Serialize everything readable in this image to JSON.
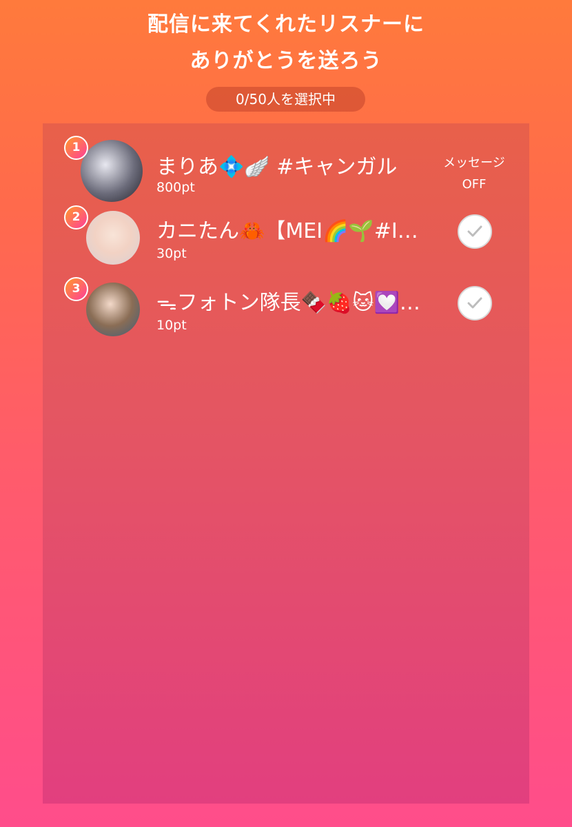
{
  "header": {
    "title_line1": "配信に来てくれたリスナーに",
    "title_line2": "ありがとうを送ろう",
    "counter": "0/50人を選択中"
  },
  "listeners": [
    {
      "rank": "1",
      "name": "まりあ💠🪽 #キャンガル",
      "points": "800pt",
      "message_status_line1": "メッセージ",
      "message_status_line2": "OFF",
      "selectable": false
    },
    {
      "rank": "2",
      "name": "カニたん🦀【MEI🌈🌱#I…",
      "points": "30pt",
      "selectable": true,
      "selected": false
    },
    {
      "rank": "3",
      "name": "ᯓフォトン隊長🍫🍓🐱💟…",
      "points": "10pt",
      "selectable": true,
      "selected": false
    }
  ],
  "colors": {
    "background_top": "#ff7a3c",
    "background_bottom": "#ff4d8b",
    "panel": "#e45563",
    "check_gray": "#bdbdbd"
  }
}
